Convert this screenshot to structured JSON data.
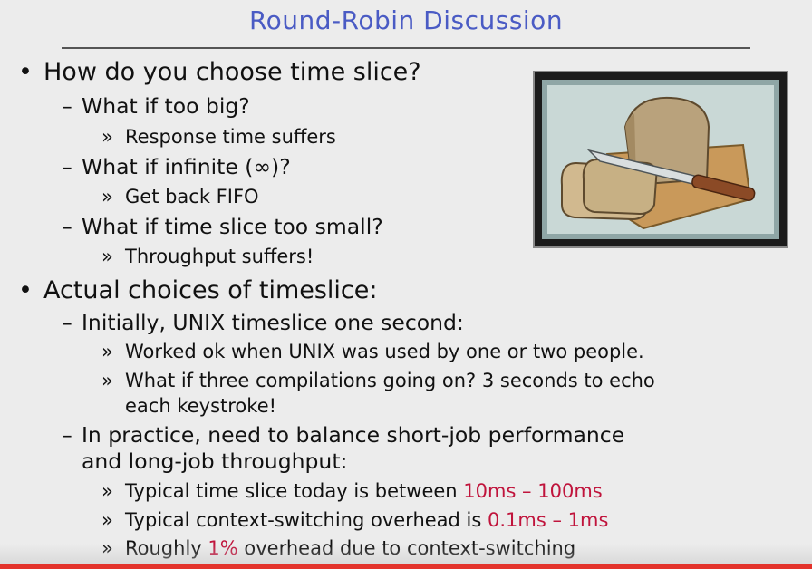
{
  "title": "Round-Robin Discussion",
  "bullets": [
    {
      "text": "How do you choose time slice?",
      "marker": "•"
    },
    {
      "text": "What if too big?",
      "marker": "–"
    },
    {
      "text": "Response time suffers",
      "marker": "»"
    },
    {
      "text": "What if infinite (∞)?",
      "marker": "–"
    },
    {
      "text": "Get back FIFO",
      "marker": "»"
    },
    {
      "text": "What if time slice too small?",
      "marker": "–"
    },
    {
      "text": "Throughput suffers!",
      "marker": "»"
    },
    {
      "text": "Actual choices of timeslice:",
      "marker": "•"
    },
    {
      "text": "Initially, UNIX timeslice one second:",
      "marker": "–"
    },
    {
      "text": "Worked ok when UNIX was used by one or two people.",
      "marker": "»"
    },
    {
      "text": "What if three compilations going on? 3 seconds to echo",
      "marker": "»"
    },
    {
      "text": "each keystroke!",
      "marker": ""
    },
    {
      "text": "In practice, need to balance short-job performance",
      "marker": "–"
    },
    {
      "text": "and long-job throughput:",
      "marker": ""
    }
  ],
  "typical_slice": {
    "marker": "»",
    "prefix": "Typical time slice today is between ",
    "highlight": "10ms – 100ms"
  },
  "typical_overhead": {
    "marker": "»",
    "prefix": "Typical context-switching overhead is ",
    "highlight": "0.1ms – 1ms"
  },
  "roughly": {
    "marker": "»",
    "prefix": "Roughly ",
    "highlight": "1%",
    "suffix": " overhead due to context-switching"
  },
  "colors": {
    "title": "#4a5bc4",
    "highlight": "#c0143c",
    "bottom_bar": "#e3332b"
  },
  "image": {
    "icon": "bread-loaf-and-knife-illustration"
  }
}
